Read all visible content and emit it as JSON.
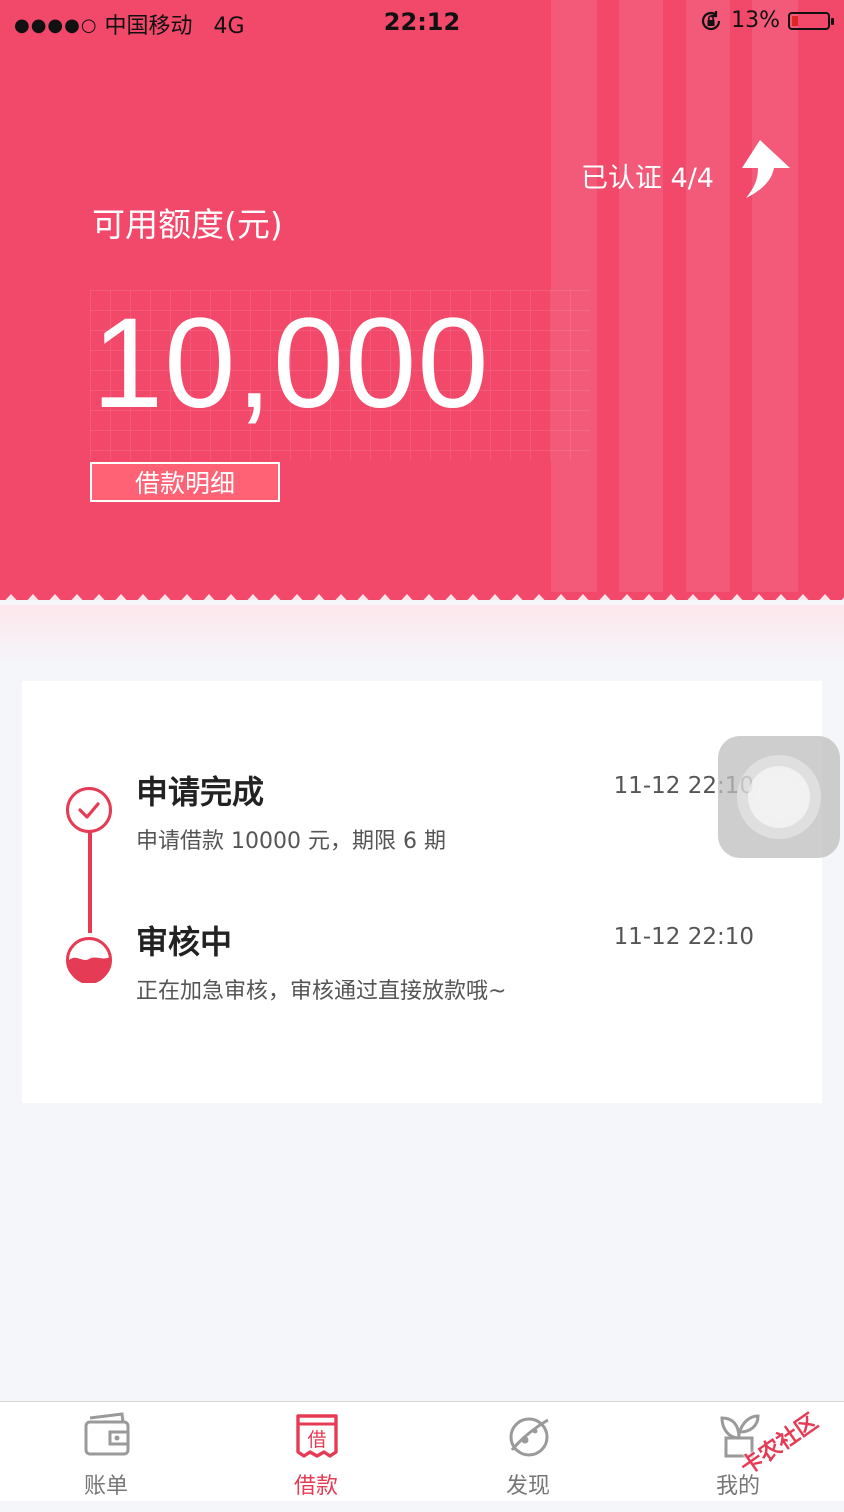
{
  "status_bar": {
    "signal_dots": "●●●●○",
    "carrier": "中国移动",
    "network": "4G",
    "time": "22:12",
    "battery": "13%"
  },
  "header": {
    "certification": "已认证 4/4",
    "limit_label": "可用额度(元)",
    "amount": "10,000",
    "detail_button": "借款明细"
  },
  "timeline": [
    {
      "title": "申请完成",
      "time": "11-12 22:10",
      "description": "申请借款 10000 元，期限 6 期",
      "state": "done"
    },
    {
      "title": "审核中",
      "time": "11-12 22:10",
      "description": "正在加急审核，审核通过直接放款哦~",
      "state": "in-progress"
    }
  ],
  "tabbar": {
    "items": [
      {
        "label": "账单",
        "icon": "wallet-icon"
      },
      {
        "label": "借款",
        "icon": "loan-icon"
      },
      {
        "label": "发现",
        "icon": "planet-icon"
      },
      {
        "label": "我的",
        "icon": "plant-icon"
      }
    ],
    "active_index": 1
  },
  "watermark": "卡农社区",
  "colors": {
    "brand": "#f2486a",
    "accent": "#e63b55",
    "background": "#f5f6fa"
  }
}
